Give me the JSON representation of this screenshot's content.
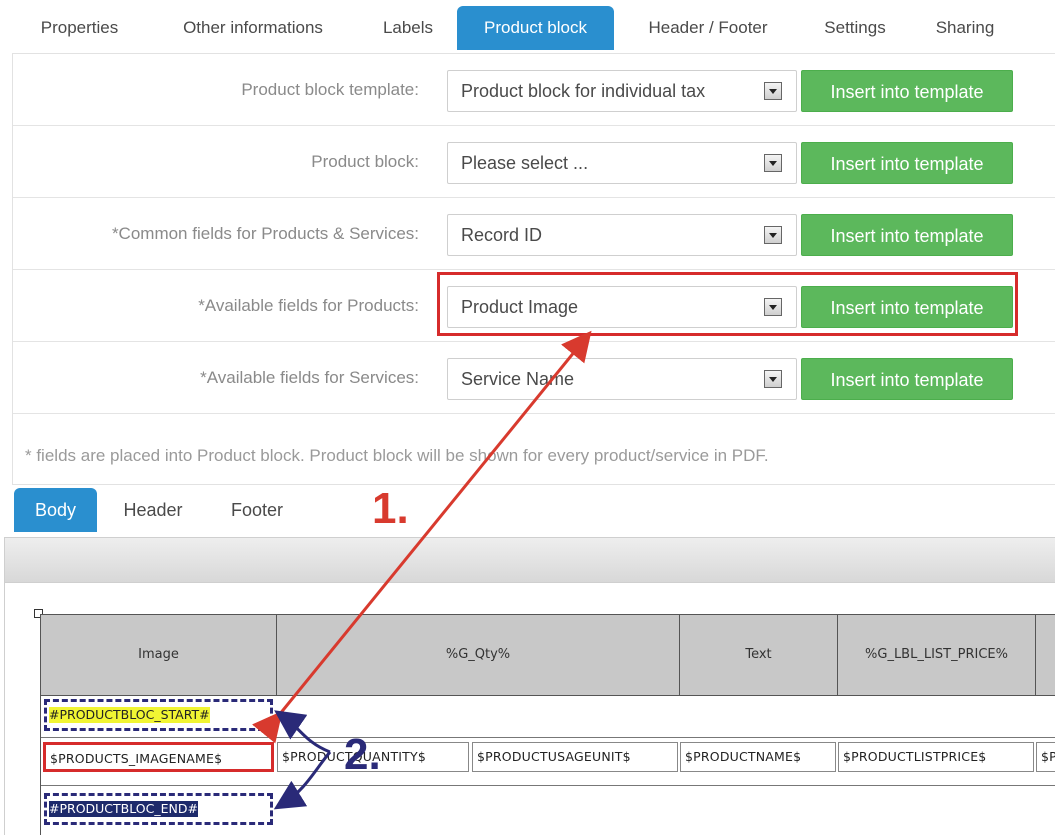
{
  "tabs": [
    "Properties",
    "Other informations",
    "Labels",
    "Product block",
    "Header / Footer",
    "Settings",
    "Sharing"
  ],
  "form": {
    "rows": [
      {
        "label": "Product block template:",
        "value": "Product block for individual tax",
        "button": "Insert into template"
      },
      {
        "label": "Product block:",
        "value": "Please select ...",
        "button": "Insert into template"
      },
      {
        "label": "*Common fields for Products & Services:",
        "value": "Record ID",
        "button": "Insert into template"
      },
      {
        "label": "*Available fields for Products:",
        "value": "Product Image",
        "button": "Insert into template"
      },
      {
        "label": "*Available fields for Services:",
        "value": "Service Name",
        "button": "Insert into template"
      }
    ],
    "note": "* fields are placed into Product block. Product block will be shown for every product/service in PDF."
  },
  "editor_tabs": [
    "Body",
    "Header",
    "Footer"
  ],
  "table": {
    "headers": [
      "Image",
      "%G_Qty%",
      "Text",
      "%G_LBL_LIST_PRICE%"
    ],
    "start_marker": "#PRODUCTBLOC_START#",
    "cells": [
      "$PRODUCTS_IMAGENAME$",
      "$PRODUCTQUANTITY$",
      "$PRODUCTUSAGEUNIT$",
      "$PRODUCTNAME$",
      "$PRODUCTLISTPRICE$",
      "$PRODUCTTOTAL$"
    ],
    "end_marker": "#PRODUCTBLOC_END#"
  },
  "annotations": {
    "step1": "1.",
    "step2": "2."
  },
  "colors": {
    "tab_active": "#2a8fcf",
    "button_green": "#5cb85c",
    "highlight_red": "#d62b2b",
    "arrow_red": "#d83a2e",
    "arrow_navy": "#2a2a78",
    "start_highlight": "#f1f533",
    "end_highlight": "#1d2a6b"
  }
}
